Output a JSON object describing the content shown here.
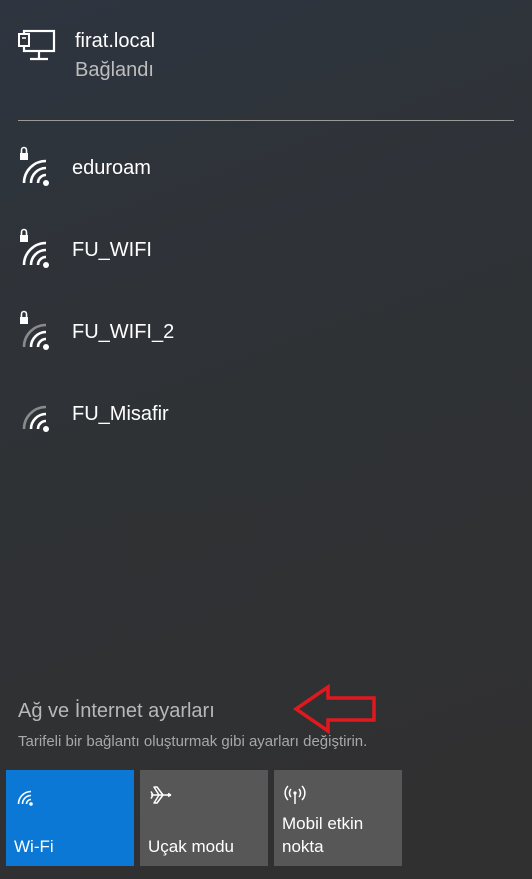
{
  "ethernet": {
    "name": "firat.local",
    "status": "Bağlandı",
    "icon": "monitor-network-icon"
  },
  "networks": [
    {
      "name": "eduroam",
      "secured": true,
      "signal": "full"
    },
    {
      "name": "FU_WIFI",
      "secured": true,
      "signal": "full"
    },
    {
      "name": "FU_WIFI_2",
      "secured": true,
      "signal": "medium"
    },
    {
      "name": "FU_Misafir",
      "secured": false,
      "signal": "medium"
    }
  ],
  "settings": {
    "link": "Ağ ve İnternet ayarları",
    "description": "Tarifeli bir bağlantı oluşturmak gibi ayarları değiştirin."
  },
  "quick_actions": [
    {
      "label": "Wi-Fi",
      "icon": "wifi-icon",
      "active": true
    },
    {
      "label": "Uçak modu",
      "icon": "airplane-icon",
      "active": false
    },
    {
      "label": "Mobil etkin nokta",
      "icon": "hotspot-icon",
      "active": false
    }
  ],
  "colors": {
    "accent": "#0a78d4",
    "tile": "#575757",
    "annotation_arrow": "#e0191f"
  }
}
